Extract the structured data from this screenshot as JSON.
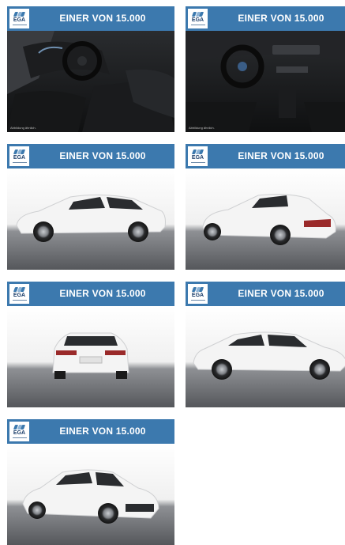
{
  "banner_text": "EINER VON 15.000",
  "logo_text": "EGA",
  "interior_caption": "Abbildung ähnlich.",
  "tiles": [
    {
      "name": "interior-driver-side"
    },
    {
      "name": "interior-dashboard"
    },
    {
      "name": "exterior-side-left"
    },
    {
      "name": "exterior-rear-three-quarter"
    },
    {
      "name": "exterior-rear"
    },
    {
      "name": "exterior-side-right"
    },
    {
      "name": "exterior-front-three-quarter"
    }
  ],
  "colors": {
    "banner": "#3c79ae",
    "logo_text": "#1d3f6b",
    "car": "#f3f3f3",
    "floor": "#5f6165"
  }
}
